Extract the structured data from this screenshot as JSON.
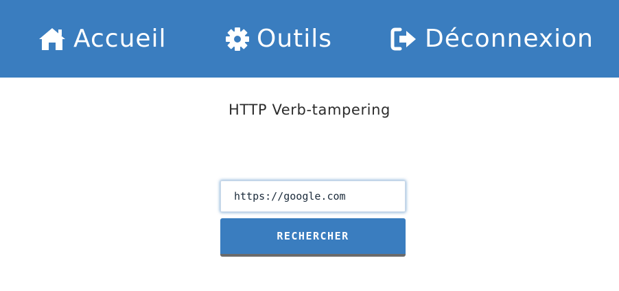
{
  "nav": {
    "home": {
      "label": "Accueil",
      "icon": "home-icon"
    },
    "tools": {
      "label": "Outils",
      "icon": "gear-icon"
    },
    "logout": {
      "label": "Déconnexion",
      "icon": "sign-out-icon"
    }
  },
  "main": {
    "title": "HTTP Verb-tampering",
    "url_input": {
      "value": "https://google.com",
      "placeholder": ""
    },
    "search_button_label": "RECHERCHER"
  },
  "colors": {
    "primary": "#3a7dbf",
    "button_shadow": "#6b6b6b",
    "text": "#2c2c2c"
  }
}
